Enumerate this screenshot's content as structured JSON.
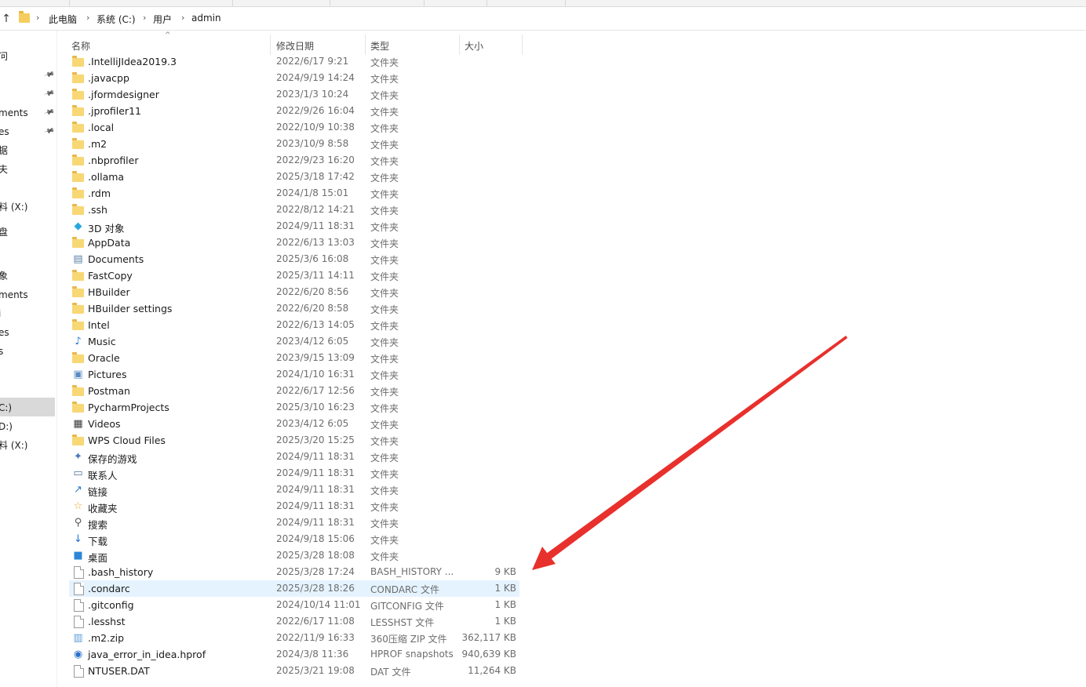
{
  "address": {
    "crumbs": [
      "此电脑",
      "系统 (C:)",
      "用户",
      "admin"
    ]
  },
  "nav": {
    "items": [
      {
        "label": "问",
        "pinned": false
      },
      {
        "label": "",
        "pinned": true
      },
      {
        "label": "",
        "pinned": true
      },
      {
        "label": "ments",
        "pinned": true
      },
      {
        "label": "es",
        "pinned": true
      },
      {
        "label": "据",
        "pinned": false
      },
      {
        "label": "夫",
        "pinned": false
      },
      {
        "label": "",
        "pinned": false
      },
      {
        "label": "料 (X:)",
        "pinned": false
      },
      {
        "label": "盘",
        "pinned": false
      },
      {
        "label": "",
        "pinned": false
      },
      {
        "label": "象",
        "pinned": false
      },
      {
        "label": "ments",
        "pinned": false
      },
      {
        "label": "i",
        "pinned": false
      },
      {
        "label": "es",
        "pinned": false
      },
      {
        "label": "s",
        "pinned": false
      },
      {
        "label": "",
        "pinned": false
      },
      {
        "label": "C:)",
        "pinned": false
      },
      {
        "label": "D:)",
        "pinned": false
      },
      {
        "label": "料 (X:)",
        "pinned": false
      }
    ]
  },
  "columns": {
    "name": "名称",
    "date": "修改日期",
    "type": "类型",
    "size": "大小"
  },
  "files": [
    {
      "name": ".IntelliJIdea2019.3",
      "date": "2022/6/17 9:21",
      "type": "文件夹",
      "size": "",
      "icon": "folder-icon"
    },
    {
      "name": ".javacpp",
      "date": "2024/9/19 14:24",
      "type": "文件夹",
      "size": "",
      "icon": "folder-icon"
    },
    {
      "name": ".jformdesigner",
      "date": "2023/1/3 10:24",
      "type": "文件夹",
      "size": "",
      "icon": "folder-icon"
    },
    {
      "name": ".jprofiler11",
      "date": "2022/9/26 16:04",
      "type": "文件夹",
      "size": "",
      "icon": "folder-icon"
    },
    {
      "name": ".local",
      "date": "2022/10/9 10:38",
      "type": "文件夹",
      "size": "",
      "icon": "folder-icon"
    },
    {
      "name": ".m2",
      "date": "2023/10/9 8:58",
      "type": "文件夹",
      "size": "",
      "icon": "folder-icon"
    },
    {
      "name": ".nbprofiler",
      "date": "2022/9/23 16:20",
      "type": "文件夹",
      "size": "",
      "icon": "folder-icon"
    },
    {
      "name": ".ollama",
      "date": "2025/3/18 17:42",
      "type": "文件夹",
      "size": "",
      "icon": "folder-icon"
    },
    {
      "name": ".rdm",
      "date": "2024/1/8 15:01",
      "type": "文件夹",
      "size": "",
      "icon": "folder-icon"
    },
    {
      "name": ".ssh",
      "date": "2022/8/12 14:21",
      "type": "文件夹",
      "size": "",
      "icon": "folder-icon"
    },
    {
      "name": "3D 对象",
      "date": "2024/9/11 18:31",
      "type": "文件夹",
      "size": "",
      "icon": "3d-objects-icon"
    },
    {
      "name": "AppData",
      "date": "2022/6/13 13:03",
      "type": "文件夹",
      "size": "",
      "icon": "folder-icon"
    },
    {
      "name": "Documents",
      "date": "2025/3/6 16:08",
      "type": "文件夹",
      "size": "",
      "icon": "documents-icon"
    },
    {
      "name": "FastCopy",
      "date": "2025/3/11 14:11",
      "type": "文件夹",
      "size": "",
      "icon": "folder-icon"
    },
    {
      "name": "HBuilder",
      "date": "2022/6/20 8:56",
      "type": "文件夹",
      "size": "",
      "icon": "folder-icon"
    },
    {
      "name": "HBuilder settings",
      "date": "2022/6/20 8:58",
      "type": "文件夹",
      "size": "",
      "icon": "folder-icon"
    },
    {
      "name": "Intel",
      "date": "2022/6/13 14:05",
      "type": "文件夹",
      "size": "",
      "icon": "folder-icon"
    },
    {
      "name": "Music",
      "date": "2023/4/12 6:05",
      "type": "文件夹",
      "size": "",
      "icon": "music-icon"
    },
    {
      "name": "Oracle",
      "date": "2023/9/15 13:09",
      "type": "文件夹",
      "size": "",
      "icon": "folder-icon"
    },
    {
      "name": "Pictures",
      "date": "2024/1/10 16:31",
      "type": "文件夹",
      "size": "",
      "icon": "pictures-icon"
    },
    {
      "name": "Postman",
      "date": "2022/6/17 12:56",
      "type": "文件夹",
      "size": "",
      "icon": "folder-icon"
    },
    {
      "name": "PycharmProjects",
      "date": "2025/3/10 16:23",
      "type": "文件夹",
      "size": "",
      "icon": "folder-icon"
    },
    {
      "name": "Videos",
      "date": "2023/4/12 6:05",
      "type": "文件夹",
      "size": "",
      "icon": "videos-icon"
    },
    {
      "name": "WPS Cloud Files",
      "date": "2025/3/20 15:25",
      "type": "文件夹",
      "size": "",
      "icon": "folder-icon"
    },
    {
      "name": "保存的游戏",
      "date": "2024/9/11 18:31",
      "type": "文件夹",
      "size": "",
      "icon": "saved-games-icon"
    },
    {
      "name": "联系人",
      "date": "2024/9/11 18:31",
      "type": "文件夹",
      "size": "",
      "icon": "contacts-icon"
    },
    {
      "name": "链接",
      "date": "2024/9/11 18:31",
      "type": "文件夹",
      "size": "",
      "icon": "links-icon"
    },
    {
      "name": "收藏夹",
      "date": "2024/9/11 18:31",
      "type": "文件夹",
      "size": "",
      "icon": "favorites-icon"
    },
    {
      "name": "搜索",
      "date": "2024/9/11 18:31",
      "type": "文件夹",
      "size": "",
      "icon": "search-icon"
    },
    {
      "name": "下载",
      "date": "2024/9/18 15:06",
      "type": "文件夹",
      "size": "",
      "icon": "downloads-icon"
    },
    {
      "name": "桌面",
      "date": "2025/3/28 18:08",
      "type": "文件夹",
      "size": "",
      "icon": "desktop-icon"
    },
    {
      "name": ".bash_history",
      "date": "2025/3/28 17:24",
      "type": "BASH_HISTORY ...",
      "size": "9 KB",
      "icon": "file-icon"
    },
    {
      "name": ".condarc",
      "date": "2025/3/28 18:26",
      "type": "CONDARC 文件",
      "size": "1 KB",
      "icon": "file-icon",
      "highlighted": true
    },
    {
      "name": ".gitconfig",
      "date": "2024/10/14 11:01",
      "type": "GITCONFIG 文件",
      "size": "1 KB",
      "icon": "file-icon"
    },
    {
      "name": ".lesshst",
      "date": "2022/6/17 11:08",
      "type": "LESSHST 文件",
      "size": "1 KB",
      "icon": "file-icon"
    },
    {
      "name": ".m2.zip",
      "date": "2022/11/9 16:33",
      "type": "360压缩 ZIP 文件",
      "size": "362,117 KB",
      "icon": "zip-archive-icon"
    },
    {
      "name": "java_error_in_idea.hprof",
      "date": "2024/3/8 11:36",
      "type": "HPROF snapshots",
      "size": "940,639 KB",
      "icon": "hprof-snapshot-icon"
    },
    {
      "name": "NTUSER.DAT",
      "date": "2025/3/21 19:08",
      "type": "DAT 文件",
      "size": "11,264 KB",
      "icon": "file-icon"
    }
  ],
  "colors": {
    "highlight_row": "#e5f3ff",
    "annotation_arrow": "#e8302c",
    "folder": "#f8d775"
  }
}
